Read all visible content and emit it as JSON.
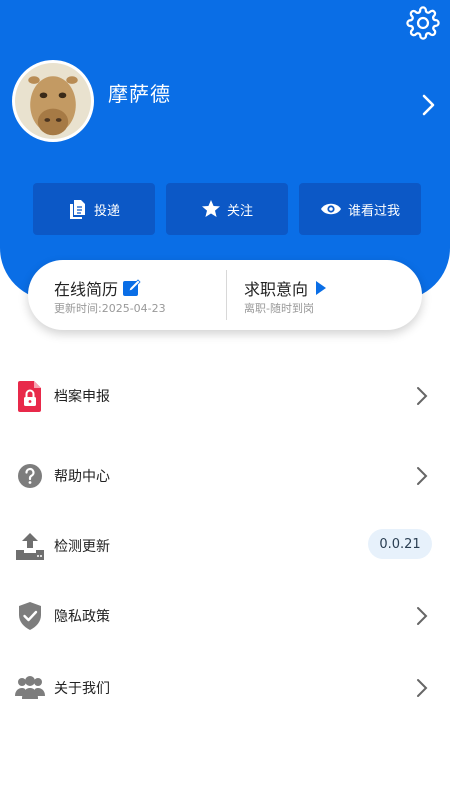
{
  "profile": {
    "username": "摩萨德"
  },
  "actions": [
    {
      "label": "投递",
      "icon": "document-icon"
    },
    {
      "label": "关注",
      "icon": "star-icon"
    },
    {
      "label": "谁看过我",
      "icon": "eye-icon"
    }
  ],
  "resume_card": {
    "resume": {
      "title": "在线简历",
      "subtitle": "更新时间:2025-04-23",
      "icon": "edit-icon"
    },
    "intention": {
      "title": "求职意向",
      "subtitle": "离职-随时到岗",
      "icon": "play-icon"
    }
  },
  "menu": [
    {
      "label": "档案申报",
      "icon": "archive-lock-icon"
    },
    {
      "label": "帮助中心",
      "icon": "question-icon"
    },
    {
      "label": "检测更新",
      "icon": "upload-icon",
      "badge": "0.0.21"
    },
    {
      "label": "隐私政策",
      "icon": "shield-check-icon"
    },
    {
      "label": "关于我们",
      "icon": "group-icon"
    }
  ],
  "colors": {
    "brand_blue": "#0a6ee6",
    "button_blue": "#0c58c6",
    "accent_red": "#e8294a",
    "badge_bg": "#e7f1fb"
  }
}
